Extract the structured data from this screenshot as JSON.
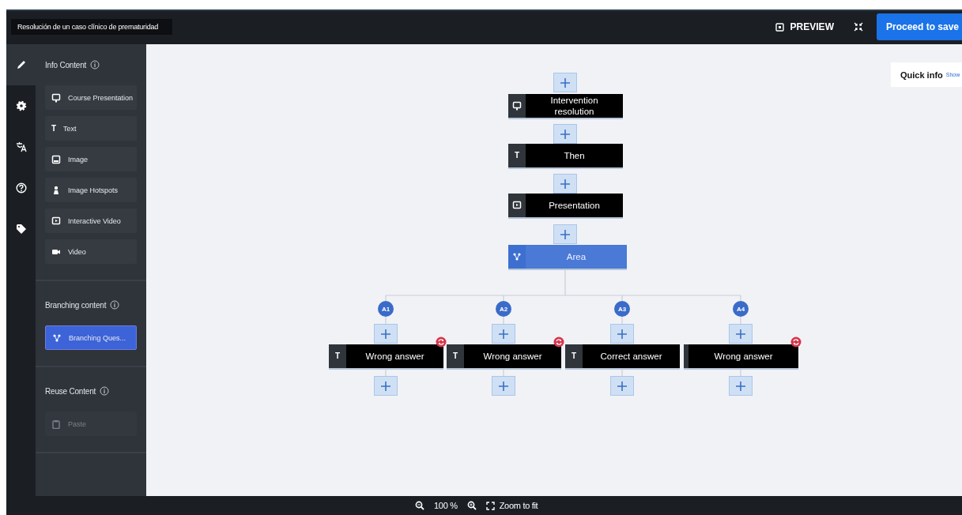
{
  "title": "Resolución de un caso clínico de prematuridad",
  "topbar": {
    "preview": "PREVIEW",
    "proceed": "Proceed to save"
  },
  "rail": [
    {
      "kind": "edit",
      "selected": true
    },
    {
      "kind": "settings",
      "selected": false
    },
    {
      "kind": "translate",
      "selected": false
    },
    {
      "kind": "help",
      "selected": false
    },
    {
      "kind": "tag",
      "selected": false
    }
  ],
  "sections": [
    {
      "heading": "Info Content",
      "items": [
        {
          "label": "Course Presentation",
          "kind": "presentation",
          "selected": false,
          "disabled": false
        },
        {
          "label": "Text",
          "kind": "text",
          "icon": "T",
          "selected": false,
          "disabled": false
        },
        {
          "label": "Image",
          "kind": "image",
          "selected": false,
          "disabled": false
        },
        {
          "label": "Image Hotspots",
          "kind": "hotspot",
          "selected": false,
          "disabled": false
        },
        {
          "label": "Interactive Video",
          "kind": "interactive-video",
          "selected": false,
          "disabled": false
        },
        {
          "label": "Video",
          "kind": "video",
          "selected": false,
          "disabled": false
        }
      ]
    },
    {
      "heading": "Branching content",
      "items": [
        {
          "label": "Branching Ques...",
          "kind": "branching",
          "selected": true,
          "disabled": false
        }
      ]
    },
    {
      "heading": "Reuse Content",
      "items": [
        {
          "label": "Paste",
          "kind": "paste",
          "selected": false,
          "disabled": true
        }
      ]
    }
  ],
  "quick_info": {
    "label": "Quick info",
    "link": "Show"
  },
  "flow": {
    "nodes": [
      {
        "label": "Intervention resolution",
        "kind": "presentation"
      },
      {
        "label": "Then",
        "kind": "text",
        "icon": "T"
      },
      {
        "label": "Presentation",
        "kind": "interactive-video"
      },
      {
        "label": "Area",
        "kind": "branching"
      }
    ],
    "answers": [
      {
        "badge": "A1",
        "label": "Wrong answer",
        "kind": "text",
        "icon": "T",
        "reset": true
      },
      {
        "badge": "A2",
        "label": "Wrong answer",
        "kind": "text",
        "icon": "T",
        "reset": true
      },
      {
        "badge": "A3",
        "label": "Correct answer",
        "kind": "text",
        "icon": "T",
        "reset": false
      },
      {
        "badge": "A4",
        "label": "Wrong answer",
        "kind": "none",
        "reset": true
      }
    ]
  },
  "zoom": {
    "level_text": "100 %",
    "fit": "Zoom to fit"
  }
}
